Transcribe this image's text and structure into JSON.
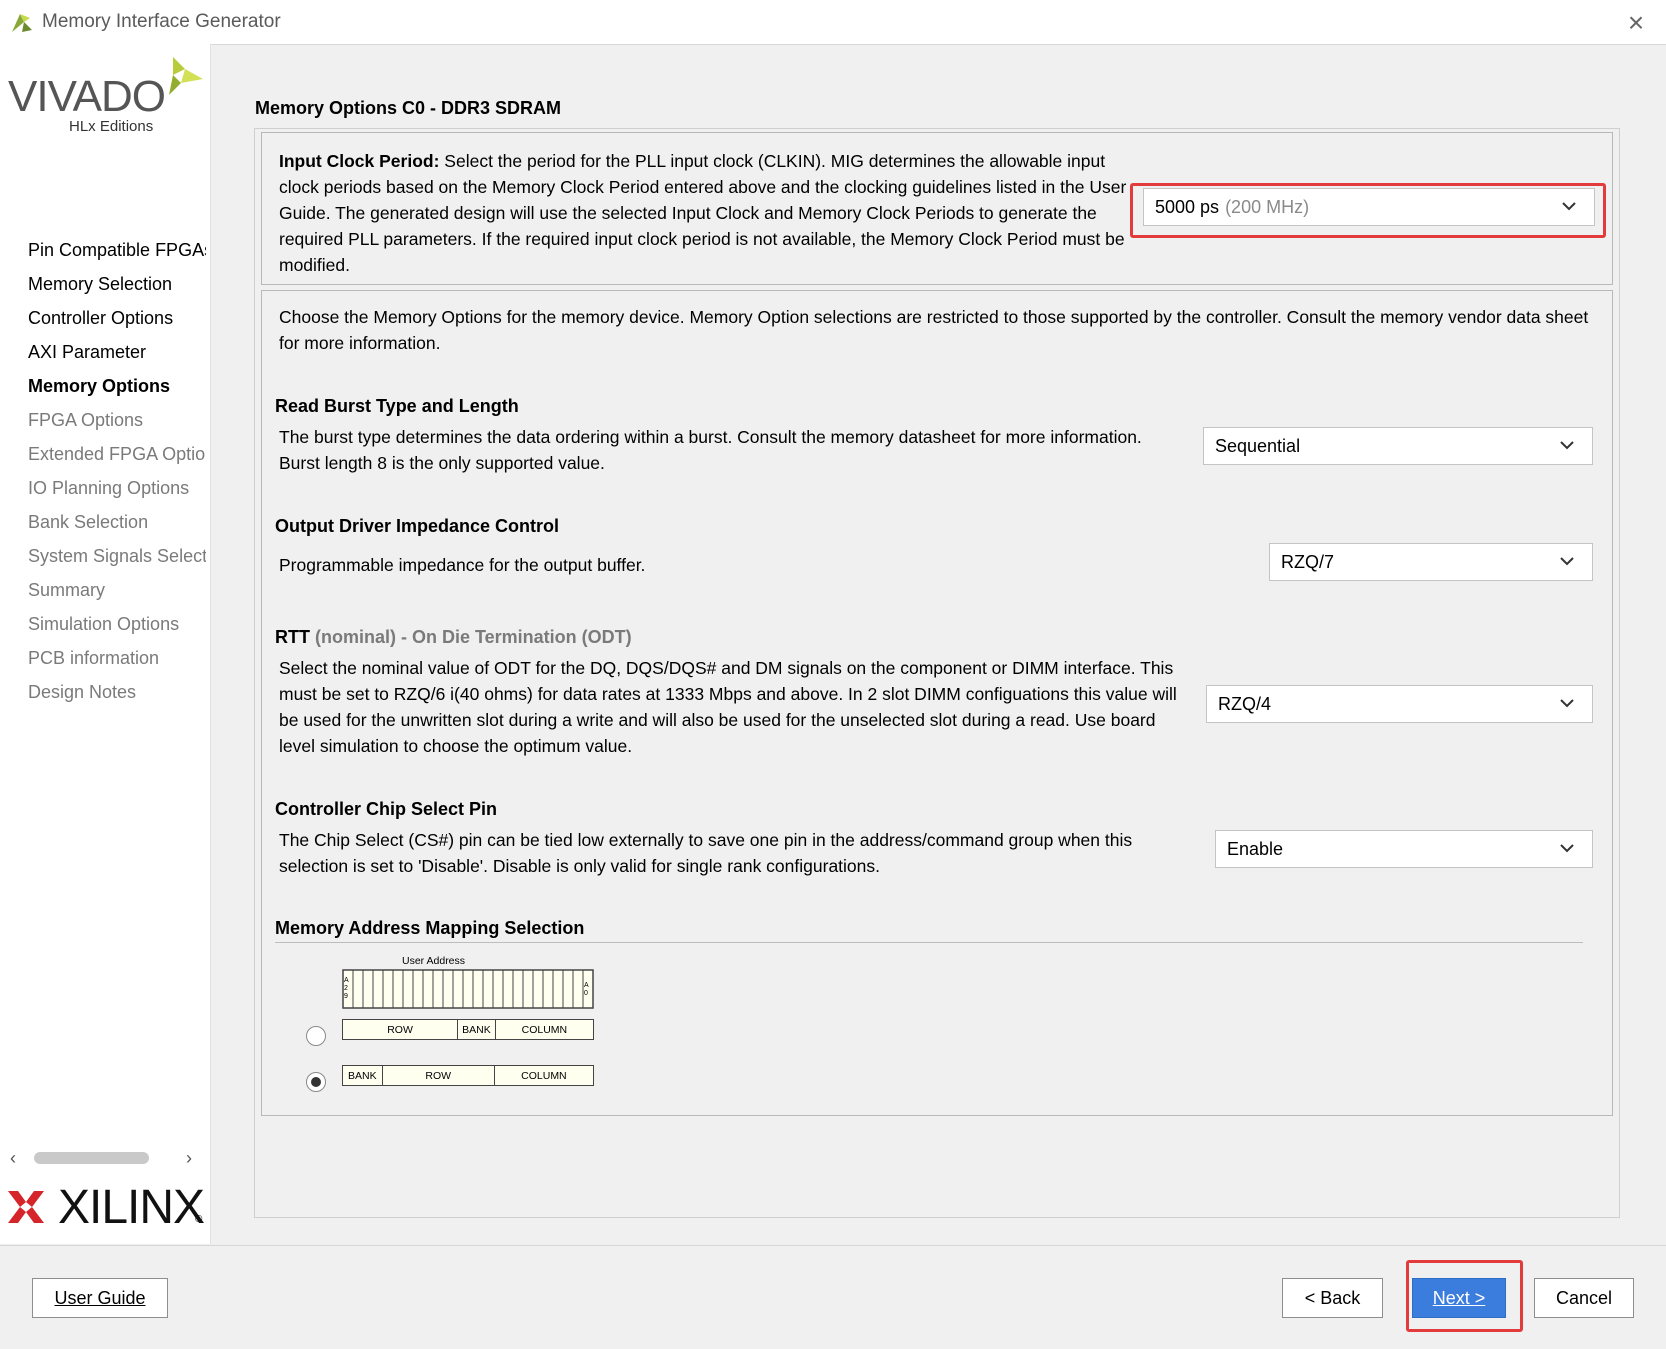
{
  "window": {
    "title": "Memory Interface Generator",
    "close_icon": "close-icon"
  },
  "sidebar": {
    "vivado_logo_text": "VIVADO",
    "vivado_edition": "HLx Editions",
    "steps": [
      {
        "label": "Pin Compatible FPGAs",
        "state": "done"
      },
      {
        "label": "Memory Selection",
        "state": "done"
      },
      {
        "label": "Controller Options",
        "state": "done"
      },
      {
        "label": "AXI Parameter",
        "state": "done"
      },
      {
        "label": "Memory Options",
        "state": "current"
      },
      {
        "label": "FPGA Options",
        "state": "pending"
      },
      {
        "label": "Extended FPGA Options",
        "state": "pending"
      },
      {
        "label": "IO Planning Options",
        "state": "pending"
      },
      {
        "label": "Bank Selection",
        "state": "pending"
      },
      {
        "label": "System Signals Selection",
        "state": "pending"
      },
      {
        "label": "Summary",
        "state": "pending"
      },
      {
        "label": "Simulation Options",
        "state": "pending"
      },
      {
        "label": "PCB information",
        "state": "pending"
      },
      {
        "label": "Design Notes",
        "state": "pending"
      }
    ],
    "xilinx_logo_text": "XILINX",
    "xilinx_reg": "®"
  },
  "main": {
    "page_title": "Memory Options C0 - DDR3 SDRAM",
    "input_clock": {
      "label": "Input Clock Period:",
      "description": " Select the period for the PLL input clock (CLKIN). MIG determines the allowable input clock periods based on the Memory Clock Period entered above and the clocking guidelines listed in the User Guide. The generated design will use the selected Input Clock and Memory Clock Periods to generate the required PLL parameters. If the required input clock period is not available, the Memory Clock Period must be modified.",
      "value": "5000 ps",
      "value_hint": "(200 MHz)"
    },
    "intro": "Choose the Memory Options for the memory device. Memory Option selections are restricted to those supported by the controller. Consult the memory vendor data sheet for more information.",
    "read_burst": {
      "heading": "Read Burst Type and Length",
      "description": "The burst type determines the data ordering within a burst. Consult the memory datasheet for more information. Burst length 8 is the only supported value.",
      "value": "Sequential"
    },
    "output_driver": {
      "heading": "Output Driver Impedance Control",
      "description": "Programmable impedance for the output buffer.",
      "value": "RZQ/7"
    },
    "rtt": {
      "heading_main": "RTT",
      "heading_rest": " (nominal) - On Die Termination (ODT)",
      "description": "Select the nominal value of ODT for the DQ, DQS/DQS# and DM signals on the component or DIMM interface. This must be set to RZQ/6 i(40 ohms) for data rates at 1333 Mbps and above. In 2 slot DIMM configuations this value will be used for the unwritten slot during a write and will also be used for the unselected slot during a read. Use board level simulation to choose the optimum value.",
      "value": "RZQ/4"
    },
    "chip_select": {
      "heading": "Controller Chip Select Pin",
      "description": "The Chip Select (CS#) pin can be tied low externally to save one pin in the address/command group when this selection is set to 'Disable'. Disable is only valid for single rank configurations.",
      "value": "Enable"
    },
    "address_mapping": {
      "heading": "Memory Address Mapping Selection",
      "user_address_label": "User Address",
      "msb_label": "A29",
      "lsb_label": "A0",
      "option1": {
        "segments": [
          "ROW",
          "BANK",
          "COLUMN"
        ],
        "selected": false
      },
      "option2": {
        "segments": [
          "BANK",
          "ROW",
          "COLUMN"
        ],
        "selected": true
      }
    }
  },
  "footer": {
    "user_guide": "User Guide",
    "back": "< Back",
    "next": "Next >",
    "cancel": "Cancel"
  },
  "colors": {
    "accent_next": "#3b7ddd",
    "highlight_red": "#e23b3b",
    "xilinx_red": "#d5252b",
    "vivado_green": "#a9c23f"
  }
}
